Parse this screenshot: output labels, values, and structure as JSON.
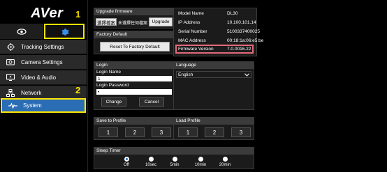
{
  "brand": {
    "logo": "AVer"
  },
  "markers": {
    "one": "1",
    "two": "2"
  },
  "icon_tabs": {
    "eye_icon": "eye-icon",
    "gear_icon": "gear-icon"
  },
  "sidebar": {
    "items": [
      {
        "label": "Tracking Settings",
        "icon": "crosshair-icon"
      },
      {
        "label": "Camera Settings",
        "icon": "camera-icon"
      },
      {
        "label": "Video & Audio",
        "icon": "video-audio-icon"
      },
      {
        "label": "Network",
        "icon": "network-icon"
      },
      {
        "label": "System",
        "icon": "pulse-icon"
      }
    ]
  },
  "upgrade": {
    "title": "Upgrade firmware",
    "choose_file": "選擇檔案",
    "no_file": "未選擇任何檔案",
    "upgrade_btn": "Upgrade"
  },
  "factory": {
    "title": "Factory Default",
    "reset_btn": "Reset To Factory Default"
  },
  "info": {
    "rows": [
      {
        "label": "Model Name",
        "value": "DL30"
      },
      {
        "label": "IP Address",
        "value": "10.100.101.14"
      },
      {
        "label": "Serial Number",
        "value": "5100337400025"
      },
      {
        "label": "MAC Address",
        "value": "00:18:1a:06:e5:be"
      },
      {
        "label": "Firmware Version",
        "value": "7.0.0016.22"
      }
    ]
  },
  "login": {
    "title": "Login",
    "name_label": "Login Name",
    "name_value": "1",
    "password_label": "Login Password",
    "password_value": "•",
    "change_btn": "Change",
    "cancel_btn": "Cancel"
  },
  "language": {
    "title": "Language",
    "selected": "English"
  },
  "save_profile": {
    "title": "Save to Profile",
    "buttons": [
      "1",
      "2",
      "3"
    ]
  },
  "load_profile": {
    "title": "Load Profile",
    "buttons": [
      "1",
      "2",
      "3"
    ]
  },
  "sleep_timer": {
    "title": "Sleep Timer",
    "options": [
      "Off",
      "10sec",
      "5min",
      "10min",
      "20min"
    ],
    "selected": "Off"
  },
  "colors": {
    "accent": "#2a6db5",
    "highlight": "#ffe600",
    "firmware_box": "#e36a7a"
  }
}
